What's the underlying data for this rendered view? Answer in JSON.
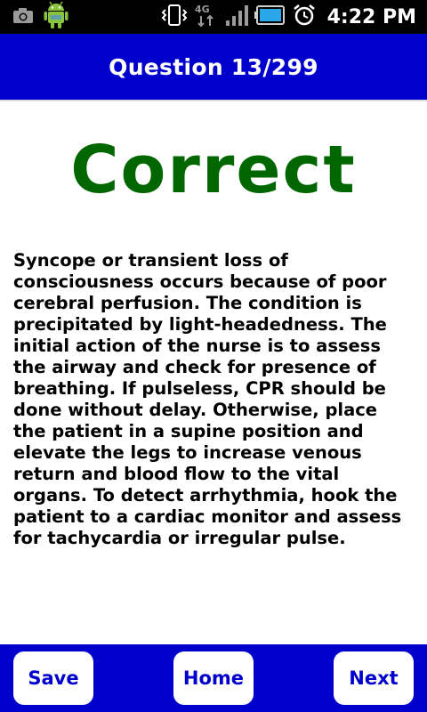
{
  "status_bar": {
    "time": "4:22 PM",
    "network_label": "4G",
    "icons": [
      "camera-icon",
      "android-icon",
      "vibrate-icon",
      "network-4g-icon",
      "signal-icon",
      "battery-icon",
      "alarm-icon"
    ]
  },
  "header": {
    "title": "Question 13/299"
  },
  "result": {
    "label": "Correct",
    "color": "#006600"
  },
  "explanation": {
    "text": "Syncope or transient loss of consciousness occurs because of poor cerebral perfusion. The condition is precipitated by light-headedness. The initial action of the nurse is to assess the airway and check for presence of breathing. If pulseless, CPR should be done without delay. Otherwise, place the patient in a supine position and elevate the legs to increase venous return and blood flow to the vital organs. To detect arrhythmia, hook the patient to a cardiac monitor and assess for tachycardia or irregular pulse."
  },
  "nav": {
    "save_label": "Save",
    "home_label": "Home",
    "next_label": "Next"
  },
  "colors": {
    "primary": "#0000cc",
    "correct": "#006600",
    "background": "#ffffff"
  }
}
